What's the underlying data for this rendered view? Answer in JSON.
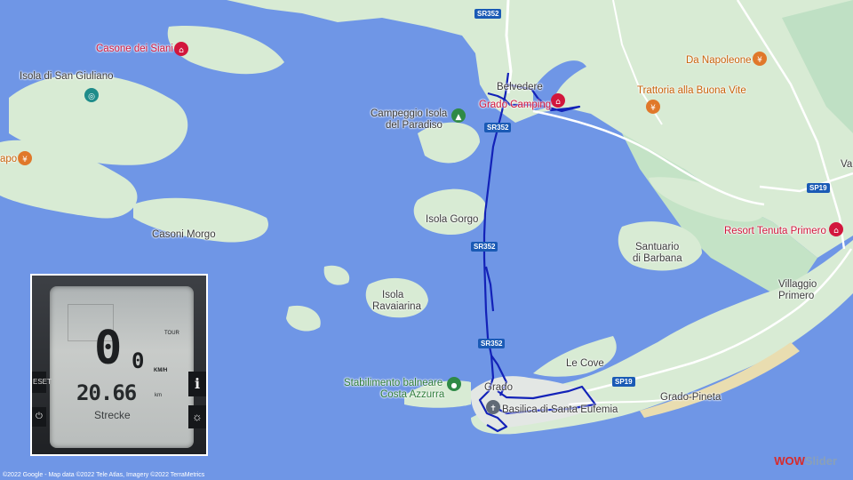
{
  "map": {
    "places": {
      "casone": "Casone dei Siani",
      "isola_giuliano": "Isola di San Giuliano",
      "apo": "apo",
      "campeggio_1": "Campeggio Isola",
      "campeggio_2": "del Paradiso",
      "belvedere": "Belvedere",
      "grado_camping": "Grado Camping",
      "da_napoleone": "Da Napoleone",
      "trattoria": "Trattoria alla Buona Vite",
      "isola_gorgo": "Isola Gorgo",
      "casoni_morgo": "Casoni Morgo",
      "santuario_1": "Santuario",
      "santuario_2": "di Barbana",
      "resort": "Resort Tenuta Primero",
      "villaggio_1": "Villaggio",
      "villaggio_2": "Primero",
      "isola_rav_1": "Isola",
      "isola_rav_2": "Ravaiarina",
      "le_cove": "Le Cove",
      "stab_1": "Stabilimento balneare",
      "stab_2": "Costa Azzurra",
      "grado": "Grado",
      "basilica": "Basilica di Santa Eufemia",
      "grado_pineta": "Grado-Pineta",
      "va": "Va"
    },
    "roads": {
      "sr352_a": "SR352",
      "sr352_b": "SR352",
      "sr352_c": "SR352",
      "sr352_d": "SR352",
      "sp19_a": "SP19",
      "sp19_b": "SP19"
    },
    "attribution": "©2022 Google - Map data ©2022 Tele Atlas, Imagery ©2022 TerraMetrics",
    "watermark_a": "WOW",
    "watermark_b": "Slider",
    "colors": {
      "water": "#6f96e6",
      "land": "#d6e9d2",
      "track": "#1322b8",
      "poi_red": "#d2163c",
      "poi_orange": "#e0782a",
      "poi_green": "#2f8a46"
    }
  },
  "device": {
    "speed": "0",
    "speed_decimal": "0",
    "speed_unit": "KM/H",
    "mode": "TOUR",
    "distance": "20.66",
    "distance_unit": "km",
    "trip_label": "Strecke",
    "set_label": "ESET",
    "info_label": "i",
    "power_icon": "power-icon",
    "light_icon": "light-icon"
  }
}
